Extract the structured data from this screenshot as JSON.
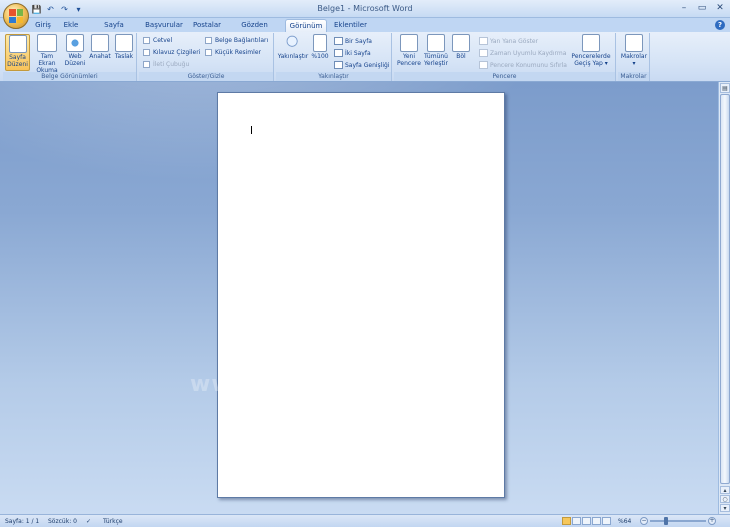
{
  "window": {
    "title": "Belge1 - Microsoft Word",
    "controls": {
      "minimize": "–",
      "maximize": "▭",
      "close": "✕"
    }
  },
  "quick_access": {
    "save_icon": "save-icon",
    "undo_icon": "undo-icon",
    "redo_icon": "redo-icon",
    "more": "▾"
  },
  "tabs": [
    {
      "label": "Giriş"
    },
    {
      "label": "Ekle"
    },
    {
      "label": "Sayfa Düzeni"
    },
    {
      "label": "Başvurular"
    },
    {
      "label": "Postalar"
    },
    {
      "label": "Gözden Geçir"
    },
    {
      "label": "Görünüm",
      "active": true
    },
    {
      "label": "Eklentiler"
    }
  ],
  "help": "?",
  "ribbon": {
    "views": {
      "label": "Belge Görünümleri",
      "print_layout": [
        "Sayfa",
        "Düzeni"
      ],
      "full_screen": [
        "Tam Ekran",
        "Okuma"
      ],
      "web": [
        "Web",
        "Düzeni"
      ],
      "outline": "Anahat",
      "draft": "Taslak"
    },
    "show_hide": {
      "label": "Göster/Gizle",
      "ruler": "Cetvel",
      "gridlines": "Kılavuz Çizgileri",
      "message_bar": "İleti Çubuğu",
      "doc_map": "Belge Bağlantıları",
      "thumbnails": "Küçük Resimler"
    },
    "zoom": {
      "label": "Yakınlaştır",
      "zoom": "Yakınlaştır",
      "hundred": "%100",
      "one_page": "Bir Sayfa",
      "two_pages": "İki Sayfa",
      "page_width": "Sayfa Genişliği"
    },
    "window": {
      "label": "Pencere",
      "new_window": [
        "Yeni",
        "Pencere"
      ],
      "arrange_all": [
        "Tümünü",
        "Yerleştir"
      ],
      "split": "Böl",
      "side_by_side": "Yan Yana Göster",
      "sync_scroll": "Zaman Uyumlu Kaydırma",
      "reset_pos": "Pencere Konumunu Sıfırla",
      "switch": [
        "Pencerelerde",
        "Geçiş Yap ▾"
      ]
    },
    "macros": {
      "label": "Makrolar",
      "macros": "Makrolar",
      "arrow": "▾"
    }
  },
  "document": {
    "watermark": "www.dijitalders.com"
  },
  "statusbar": {
    "page": "Sayfa: 1 / 1",
    "words": "Sözcük: 0",
    "language": "Türkçe",
    "zoom": "%64",
    "zoom_level": 0.64
  },
  "colors": {
    "ribbon": "#d6e4f6",
    "tab_active": "#ffffff",
    "workspace": "#8aa8d3",
    "accent": "#f6c75b"
  }
}
